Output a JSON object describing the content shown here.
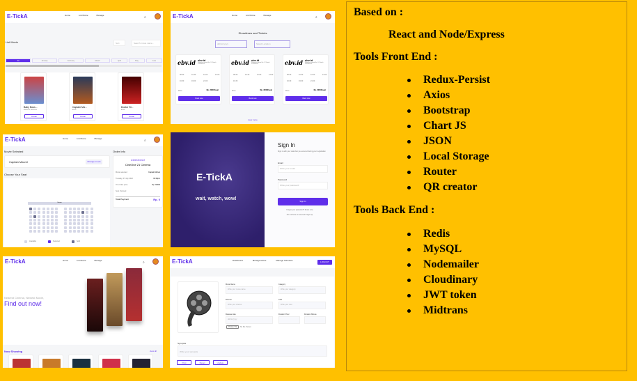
{
  "brand": "E-TickA",
  "nav": {
    "home": "Home",
    "list_movie": "List Movie",
    "manage": "Manage",
    "dashboard": "Dashboard",
    "manage_movie": "Manage Movie",
    "manage_schedule": "Manage Schedule",
    "logout": "LOGOUT"
  },
  "list_movie": {
    "title": "List Movie",
    "sort": "Sort",
    "search_placeholder": "Search movie name...",
    "months": [
      "All",
      "January",
      "February",
      "March",
      "April",
      "May",
      "June",
      "July",
      "Aug"
    ],
    "movies": [
      {
        "title": "Baby Boss...",
        "genre": "Adventure, Animation",
        "button": "Detail"
      },
      {
        "title": "Captain Ma...",
        "genre": "Action",
        "button": "Detail"
      },
      {
        "title": "Doctor St...",
        "genre": "Action",
        "button": "Detail"
      }
    ]
  },
  "showtimes": {
    "title": "Showtimes and Tickets",
    "date": "dd/mm/yyyy",
    "location": "Select Location",
    "cinemas": [
      {
        "logo": "ebv.id",
        "name": "ebv.id",
        "address": "Whatever street No. 12 South Purwokerto",
        "price_label": "Price",
        "price": "Rp. 30000/seat",
        "times": [
          "08:30",
          "10:30",
          "12:00",
          "14:00",
          "16:30",
          "19:00",
          "21:00"
        ]
      },
      {
        "logo": "ebv.id",
        "name": "ebv.id",
        "address": "Whatever street No. 12 South Purwokerto",
        "price_label": "Price",
        "price": "Rp. 30000/seat",
        "times": [
          "08:30",
          "10:30",
          "12:00",
          "14:00",
          "16:30"
        ]
      },
      {
        "logo": "ebv.id",
        "name": "ebv.id",
        "address": "Whatever street No. 12 South Purwokerto",
        "price_label": "Price",
        "price": "Rp. 30000/seat",
        "times": [
          "08:30",
          "10:30",
          "12:00",
          "14:00",
          "16:30",
          "19:00",
          "21:00"
        ]
      }
    ],
    "book_label": "Book now",
    "view_more": "view more"
  },
  "order": {
    "movie_selected": "Movie Selected",
    "movie": "Captain Marvel",
    "change": "Change movie",
    "choose_seat": "Choose Your Seat",
    "screen": "Screen",
    "legend": [
      "Available",
      "Selected",
      "Sold"
    ],
    "order_info": "Order Info",
    "cinema_logo": "CineOne21",
    "cinema": "CineOne 21 Cinema",
    "rows": [
      [
        "Movie selected",
        "Captain Marvel"
      ],
      [
        "Tuesday, 07 July 2020",
        "02:00pm"
      ],
      [
        "One ticket price",
        "Rp. 30000"
      ],
      [
        "Seat choosed",
        ""
      ]
    ],
    "total_label": "Total Payment",
    "total": "Rp. 0"
  },
  "signin": {
    "brand": "E-TickA",
    "tagline": "wait, watch, wow!",
    "title": "Sign In",
    "subtitle": "Sign in with your data that you entered during your registration",
    "email_label": "Email",
    "email_placeholder": "Write your email",
    "password_label": "Password",
    "password_placeholder": "Write your password",
    "button": "Sign In",
    "forgot": "Forgot your password? Reset now",
    "signup": "Do not have an account? Sign Up"
  },
  "home": {
    "subtitle": "Nearest Cinema, Newest Movie,",
    "headline": "Find out now!",
    "now_showing": "Now Showing",
    "view_all": "view all"
  },
  "manage": {
    "fields": [
      {
        "label": "Movie Name",
        "placeholder": "Write your movie name"
      },
      {
        "label": "Category",
        "placeholder": "Write your category"
      },
      {
        "label": "Director",
        "placeholder": "Write your director"
      },
      {
        "label": "Cast",
        "placeholder": "Write your cast"
      },
      {
        "label": "Release date",
        "placeholder": "dd/mm/yyyy"
      },
      {
        "label": "Duration Hour",
        "placeholder": ""
      },
      {
        "label": "Duration Minute",
        "placeholder": ""
      }
    ],
    "file_button": "Choose File",
    "file_text": "No file chosen",
    "synopsis_label": "Synopsis",
    "synopsis_placeholder": "Write your synopsis",
    "buttons": [
      "Post",
      "Reset",
      "Update"
    ]
  },
  "info": {
    "based_on_label": "Based on :",
    "based_on": "React and Node/Express",
    "front_label": "Tools Front End :",
    "front": [
      "Redux-Persist",
      "Axios",
      "Bootstrap",
      "Chart JS",
      "JSON",
      "Local Storage",
      "Router",
      "QR creator"
    ],
    "back_label": "Tools Back End :",
    "back": [
      "Redis",
      "MySQL",
      "Nodemailer",
      "Cloudinary",
      "JWT token",
      "Midtrans"
    ]
  },
  "colors": {
    "background": "#FFC000",
    "accent": "#5F2EEA"
  }
}
